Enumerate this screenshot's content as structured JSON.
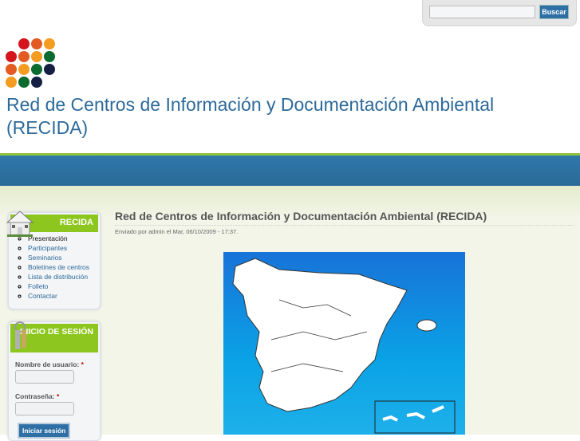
{
  "search": {
    "placeholder": "",
    "button": "Buscar"
  },
  "site": {
    "title": "Red de Centros de Información y Documentación Ambiental (RECIDA)",
    "logo_colors": [
      "#d4161c",
      "#e35a22",
      "#f39c1f",
      "#0c6b2f",
      "#151f44"
    ]
  },
  "sidebar": {
    "recida": {
      "title": "RECIDA",
      "items": [
        {
          "label": "Presentación"
        },
        {
          "label": "Participantes"
        },
        {
          "label": "Seminarios"
        },
        {
          "label": "Boletines de centros"
        },
        {
          "label": "Lista de distribución"
        },
        {
          "label": "Folleto"
        },
        {
          "label": "Contactar"
        }
      ]
    },
    "login": {
      "title": "INICIO DE SESIÓN",
      "username_label": "Nombre de usuario:",
      "password_label": "Contraseña:",
      "required": "*",
      "submit": "Iniciar sesión"
    }
  },
  "node": {
    "title": "Red de Centros de Información y Documentación Ambiental (RECIDA)",
    "submitted": "Enviado por admin el Mar, 06/10/2009 - 17:37."
  }
}
